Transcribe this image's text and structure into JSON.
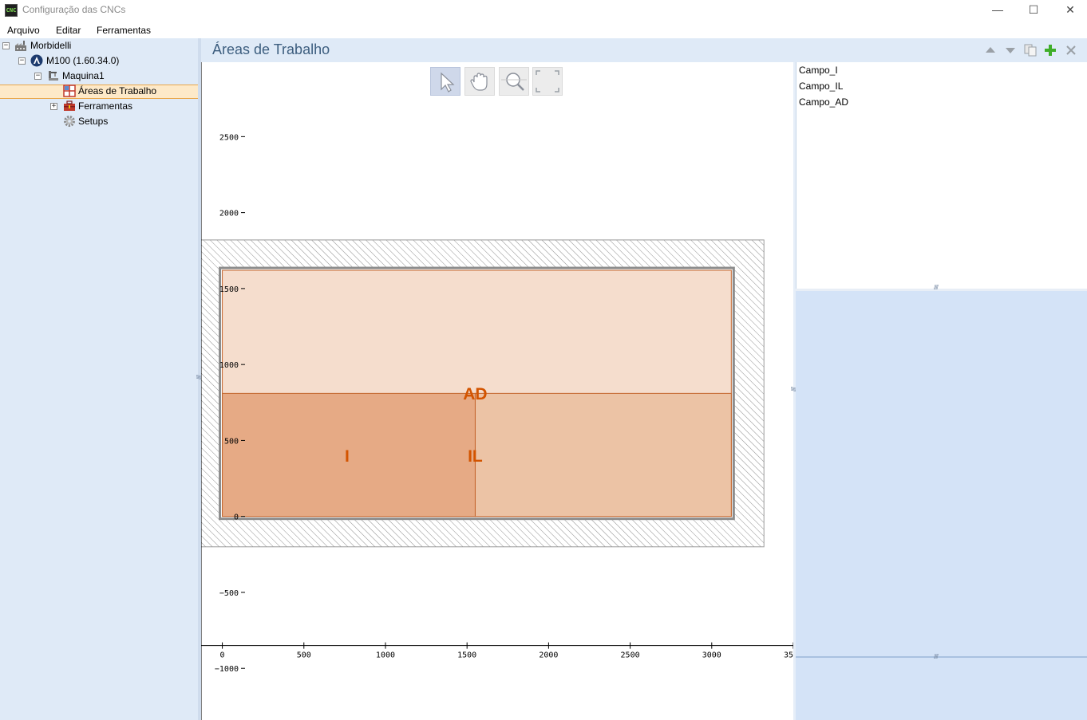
{
  "window": {
    "title": "Configuração das CNCs",
    "icon_text": "CNC",
    "minimize_icon": "minimize-icon",
    "maximize_icon": "maximize-icon",
    "close_icon": "close-icon"
  },
  "menu": [
    "Arquivo",
    "Editar",
    "Ferramentas"
  ],
  "tree": [
    {
      "label": "Morbidelli",
      "icon": "factory-icon",
      "expander": "⊟",
      "level": 0
    },
    {
      "label": "M100 (1.60.34.0)",
      "icon": "cnc-logo-icon",
      "expander": "⊟",
      "level": 1
    },
    {
      "label": "Maquina1",
      "icon": "machine-icon",
      "expander": "⊟",
      "level": 2
    },
    {
      "label": "Áreas de Trabalho",
      "icon": "work-area-grid-icon",
      "expander": "",
      "level": 3,
      "selected": true
    },
    {
      "label": "Ferramentas",
      "icon": "toolbox-icon",
      "expander": "⊞",
      "level": 3
    },
    {
      "label": "Setups",
      "icon": "gear-icon",
      "expander": "",
      "level": 3
    }
  ],
  "header": {
    "title": "Áreas de Trabalho",
    "buttons": [
      "move-up-icon",
      "move-down-icon",
      "copy-icon",
      "add-icon",
      "delete-icon"
    ]
  },
  "chart_toolbar": [
    "pointer-icon",
    "hand-pan-icon",
    "zoom-icon",
    "fit-view-icon"
  ],
  "work_areas": [
    "Campo_I",
    "Campo_IL",
    "Campo_AD"
  ],
  "chart_data": {
    "type": "scatter",
    "x_ticks": [
      "0",
      "500",
      "1000",
      "1500",
      "2000",
      "2500",
      "3000",
      "35"
    ],
    "y_ticks": [
      "2500",
      "2000",
      "1500",
      "1000",
      "500",
      "0",
      "−500",
      "−1000"
    ],
    "xlim": [
      -130,
      3500
    ],
    "ylim": [
      -1340,
      2990
    ],
    "machine_bounds": {
      "x": [
        -190,
        3320
      ],
      "y": [
        -200,
        1820
      ]
    },
    "table_bounds": {
      "x": [
        0,
        3120
      ],
      "y": [
        0,
        1620
      ]
    },
    "areas": [
      {
        "label": "AD",
        "x": [
          0,
          3120
        ],
        "y": [
          0,
          1620
        ],
        "color": "#f5ddcd"
      },
      {
        "label": "IL",
        "x": [
          1550,
          3120
        ],
        "y": [
          0,
          810
        ],
        "color": "#ecc3a5"
      },
      {
        "label": "I",
        "x": [
          0,
          1550
        ],
        "y": [
          0,
          810
        ],
        "color": "#e6aa85"
      }
    ],
    "label_color": "#d35400"
  }
}
